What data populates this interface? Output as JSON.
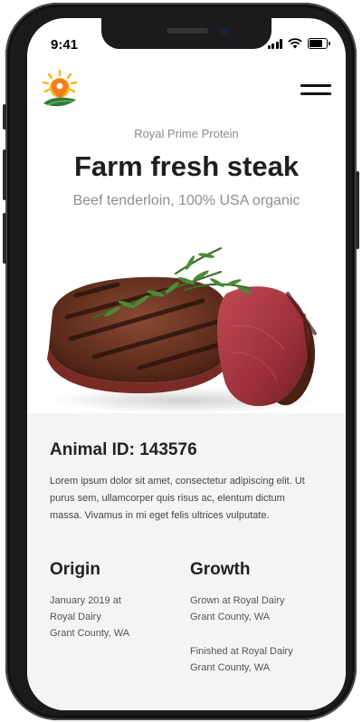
{
  "status_bar": {
    "time": "9:41",
    "battery_level": 0.9
  },
  "header": {
    "logo_icon": "sun-location-pin-logo-icon",
    "menu_icon": "hamburger-menu-icon"
  },
  "hero": {
    "eyebrow": "Royal Prime Protein",
    "title": "Farm fresh steak",
    "subtitle": "Beef tenderloin, 100% USA organic",
    "image": "grilled-steak-with-rosemary"
  },
  "details": {
    "animal_id": "Animal ID: 143576",
    "description": "Lorem ipsum dolor sit amet, consectetur adipiscing elit. Ut purus sem, ullamcorper quis risus ac, elentum dictum massa. Vivamus in mi eget felis ultrices vulputate.",
    "origin": {
      "title": "Origin",
      "lines": [
        "January 2019 at",
        "Royal Dairy",
        "Grant County, WA"
      ]
    },
    "growth": {
      "title": "Growth",
      "lines": [
        "Grown at Royal Dairy",
        "Grant County, WA",
        "Finished at Royal Dairy",
        "Grant County, WA"
      ]
    }
  },
  "colors": {
    "logo_sun": "#f5b41a",
    "logo_pin": "#ef7d1f",
    "logo_leaf": "#2e7d32",
    "info_background": "#f4f4f4"
  }
}
